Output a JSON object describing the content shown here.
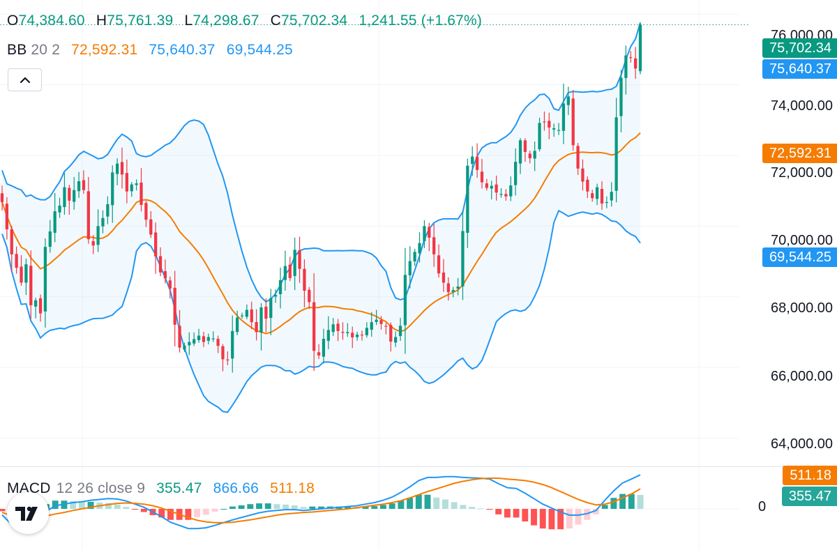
{
  "ohlc": {
    "o_label": "O",
    "o": "74,384.60",
    "h_label": "H",
    "h": "75,761.39",
    "l_label": "L",
    "l": "74,298.67",
    "c_label": "C",
    "c": "75,702.34",
    "change": "1,241.55 (+1.67%)"
  },
  "bb": {
    "name": "BB",
    "length": "20",
    "mult": "2",
    "basis": "72,592.31",
    "upper": "75,640.37",
    "lower": "69,544.25"
  },
  "macd": {
    "name": "MACD",
    "fast": "12",
    "slow": "26",
    "source": "close",
    "signal_len": "9",
    "hist": "355.47",
    "macd": "866.66",
    "signal": "511.18"
  },
  "price_axis": {
    "ticks": [
      "76,000.00",
      "74,000.00",
      "72,000.00",
      "70,000.00",
      "68,000.00",
      "66,000.00",
      "64,000.00"
    ],
    "macd_zero": "0",
    "last_price_tag": "75,702.34",
    "upper_tag": "75,640.37",
    "basis_tag": "72,592.31",
    "lower_tag": "69,544.25",
    "macd_signal_tag": "511.18",
    "macd_hist_tag": "355.47"
  },
  "colors": {
    "up": "#089981",
    "down": "#f23645",
    "basis": "#f57c00",
    "bands": "#2196f3",
    "band_fill": "#2196f3",
    "hist_up_strong": "#26a69a",
    "hist_up_weak": "#b2dfdb",
    "hist_down_strong": "#ff5252",
    "hist_down_weak": "#ffcdd2"
  },
  "chart_data": {
    "type": "line",
    "main_pane": {
      "ylim": [
        63200,
        76400
      ],
      "close": [
        70680,
        69910,
        69200,
        68820,
        68400,
        68920,
        67760,
        67900,
        67530,
        69410,
        69850,
        70420,
        70580,
        71100,
        70720,
        71020,
        71270,
        71020,
        69630,
        69450,
        70000,
        70230,
        70620,
        71520,
        71770,
        71460,
        70980,
        71180,
        71210,
        70600,
        70180,
        69760,
        69140,
        68690,
        68520,
        68230,
        67210,
        66560,
        66620,
        66720,
        66800,
        66900,
        66720,
        66860,
        66820,
        66610,
        66230,
        66200,
        67030,
        67410,
        67470,
        67630,
        67280,
        67000,
        67700,
        67380,
        67960,
        68050,
        68470,
        68870,
        68530,
        69330,
        68790,
        68170,
        67850,
        66470,
        66340,
        66810,
        67060,
        67220,
        67030,
        66980,
        67000,
        66850,
        66930,
        66910,
        67120,
        67280,
        67350,
        67230,
        67160,
        66730,
        66860,
        67180,
        68620,
        69010,
        69270,
        69520,
        70000,
        69670,
        69200,
        68660,
        68400,
        68130,
        68190,
        68290,
        69860,
        71710,
        71970,
        71590,
        71240,
        71080,
        71140,
        70950,
        70910,
        70840,
        71150,
        71820,
        72430,
        72100,
        71920,
        72130,
        72920,
        72950,
        72790,
        72770,
        72720,
        73470,
        73670,
        72290,
        71630,
        71260,
        70980,
        70790,
        71100,
        70640,
        70680,
        70970,
        73080,
        74200,
        74830,
        74780,
        74460,
        75702
      ]
    },
    "macd_pane": {
      "macd": [
        -150,
        -380,
        -360,
        -200,
        -120,
        -60,
        80,
        120,
        160,
        180,
        220,
        240,
        260,
        250,
        200,
        120,
        40,
        -80,
        -200,
        -340,
        -420,
        -500,
        -500,
        -480,
        -420,
        -350,
        -280,
        -220,
        -160,
        -100,
        -60,
        -40,
        -20,
        -20,
        -40,
        -20,
        0,
        20,
        40,
        60,
        80,
        120,
        160,
        220,
        300,
        420,
        560,
        720,
        800,
        800,
        820,
        820,
        800,
        790,
        780,
        760,
        640,
        540,
        520,
        400,
        260,
        120,
        20,
        -80,
        -160,
        -160,
        -120,
        -40,
        220,
        460,
        660,
        760,
        866.66
      ],
      "signal": [
        -90,
        -170,
        -230,
        -230,
        -210,
        -180,
        -130,
        -90,
        -40,
        0,
        40,
        80,
        110,
        140,
        150,
        140,
        120,
        80,
        20,
        -60,
        -140,
        -220,
        -290,
        -330,
        -350,
        -350,
        -340,
        -310,
        -280,
        -240,
        -200,
        -160,
        -130,
        -110,
        -90,
        -80,
        -60,
        -40,
        -20,
        0,
        30,
        60,
        90,
        120,
        160,
        210,
        280,
        360,
        440,
        510,
        580,
        650,
        700,
        740,
        770,
        780,
        780,
        760,
        740,
        720,
        680,
        620,
        540,
        440,
        340,
        240,
        160,
        100,
        120,
        180,
        280,
        380,
        511.18
      ],
      "histogram": [
        -60,
        -210,
        -130,
        30,
        90,
        120,
        210,
        210,
        200,
        180,
        180,
        160,
        150,
        110,
        50,
        -20,
        -80,
        -160,
        -220,
        -280,
        -280,
        -280,
        -210,
        -150,
        -70,
        0,
        60,
        90,
        120,
        140,
        140,
        120,
        110,
        90,
        50,
        60,
        60,
        60,
        60,
        60,
        50,
        60,
        70,
        100,
        140,
        210,
        280,
        360,
        360,
        290,
        240,
        170,
        100,
        50,
        10,
        -20,
        -140,
        -220,
        -220,
        -320,
        -420,
        -500,
        -520,
        -520,
        -500,
        -400,
        -280,
        -140,
        100,
        280,
        380,
        380,
        355.47
      ],
      "ylim": [
        -1100,
        1100
      ]
    }
  }
}
